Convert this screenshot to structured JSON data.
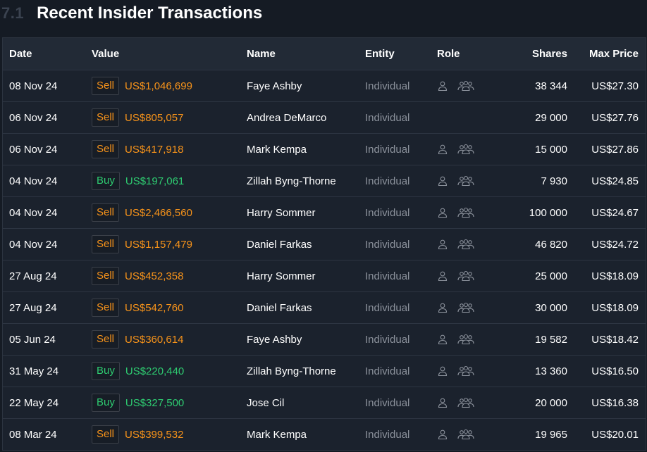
{
  "section": {
    "number": "7.1",
    "title": "Recent Insider Transactions"
  },
  "columns": {
    "date": "Date",
    "value": "Value",
    "name": "Name",
    "entity": "Entity",
    "role": "Role",
    "shares": "Shares",
    "max_price": "Max Price"
  },
  "colors": {
    "sell": "#f7931a",
    "buy": "#2ecc71",
    "background": "#151b24"
  },
  "icons": {
    "individual": "person-icon",
    "group": "group-icon"
  },
  "rows": [
    {
      "date": "08 Nov 24",
      "type": "Sell",
      "value": "US$1,046,699",
      "name": "Faye Ashby",
      "entity": "Individual",
      "role_icons": true,
      "shares": "38 344",
      "max_price": "US$27.30"
    },
    {
      "date": "06 Nov 24",
      "type": "Sell",
      "value": "US$805,057",
      "name": "Andrea DeMarco",
      "entity": "Individual",
      "role_icons": false,
      "shares": "29 000",
      "max_price": "US$27.76"
    },
    {
      "date": "06 Nov 24",
      "type": "Sell",
      "value": "US$417,918",
      "name": "Mark Kempa",
      "entity": "Individual",
      "role_icons": true,
      "shares": "15 000",
      "max_price": "US$27.86"
    },
    {
      "date": "04 Nov 24",
      "type": "Buy",
      "value": "US$197,061",
      "name": "Zillah Byng-Thorne",
      "entity": "Individual",
      "role_icons": true,
      "shares": "7 930",
      "max_price": "US$24.85"
    },
    {
      "date": "04 Nov 24",
      "type": "Sell",
      "value": "US$2,466,560",
      "name": "Harry Sommer",
      "entity": "Individual",
      "role_icons": true,
      "shares": "100 000",
      "max_price": "US$24.67"
    },
    {
      "date": "04 Nov 24",
      "type": "Sell",
      "value": "US$1,157,479",
      "name": "Daniel Farkas",
      "entity": "Individual",
      "role_icons": true,
      "shares": "46 820",
      "max_price": "US$24.72"
    },
    {
      "date": "27 Aug 24",
      "type": "Sell",
      "value": "US$452,358",
      "name": "Harry Sommer",
      "entity": "Individual",
      "role_icons": true,
      "shares": "25 000",
      "max_price": "US$18.09"
    },
    {
      "date": "27 Aug 24",
      "type": "Sell",
      "value": "US$542,760",
      "name": "Daniel Farkas",
      "entity": "Individual",
      "role_icons": true,
      "shares": "30 000",
      "max_price": "US$18.09"
    },
    {
      "date": "05 Jun 24",
      "type": "Sell",
      "value": "US$360,614",
      "name": "Faye Ashby",
      "entity": "Individual",
      "role_icons": true,
      "shares": "19 582",
      "max_price": "US$18.42"
    },
    {
      "date": "31 May 24",
      "type": "Buy",
      "value": "US$220,440",
      "name": "Zillah Byng-Thorne",
      "entity": "Individual",
      "role_icons": true,
      "shares": "13 360",
      "max_price": "US$16.50"
    },
    {
      "date": "22 May 24",
      "type": "Buy",
      "value": "US$327,500",
      "name": "Jose Cil",
      "entity": "Individual",
      "role_icons": true,
      "shares": "20 000",
      "max_price": "US$16.38"
    },
    {
      "date": "08 Mar 24",
      "type": "Sell",
      "value": "US$399,532",
      "name": "Mark Kempa",
      "entity": "Individual",
      "role_icons": true,
      "shares": "19 965",
      "max_price": "US$20.01"
    }
  ]
}
